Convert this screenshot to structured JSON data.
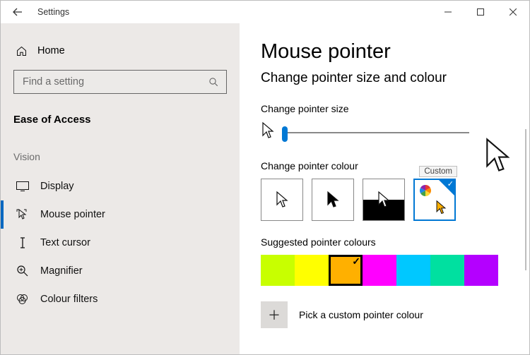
{
  "window": {
    "title": "Settings"
  },
  "sidebar": {
    "home": "Home",
    "search_placeholder": "Find a setting",
    "section": "Ease of Access",
    "group": "Vision",
    "items": [
      {
        "label": "Display"
      },
      {
        "label": "Mouse pointer"
      },
      {
        "label": "Text cursor"
      },
      {
        "label": "Magnifier"
      },
      {
        "label": "Colour filters"
      }
    ]
  },
  "content": {
    "title": "Mouse pointer",
    "subtitle": "Change pointer size and colour",
    "size_label": "Change pointer size",
    "colour_label": "Change pointer colour",
    "tooltip_custom": "Custom",
    "suggested_label": "Suggested pointer colours",
    "swatches": [
      "#c8ff00",
      "#ffff00",
      "#ffb000",
      "#ff00ff",
      "#00c8ff",
      "#00e0a0",
      "#b400ff"
    ],
    "selected_swatch_index": 2,
    "custom_picker": "Pick a custom pointer colour"
  }
}
